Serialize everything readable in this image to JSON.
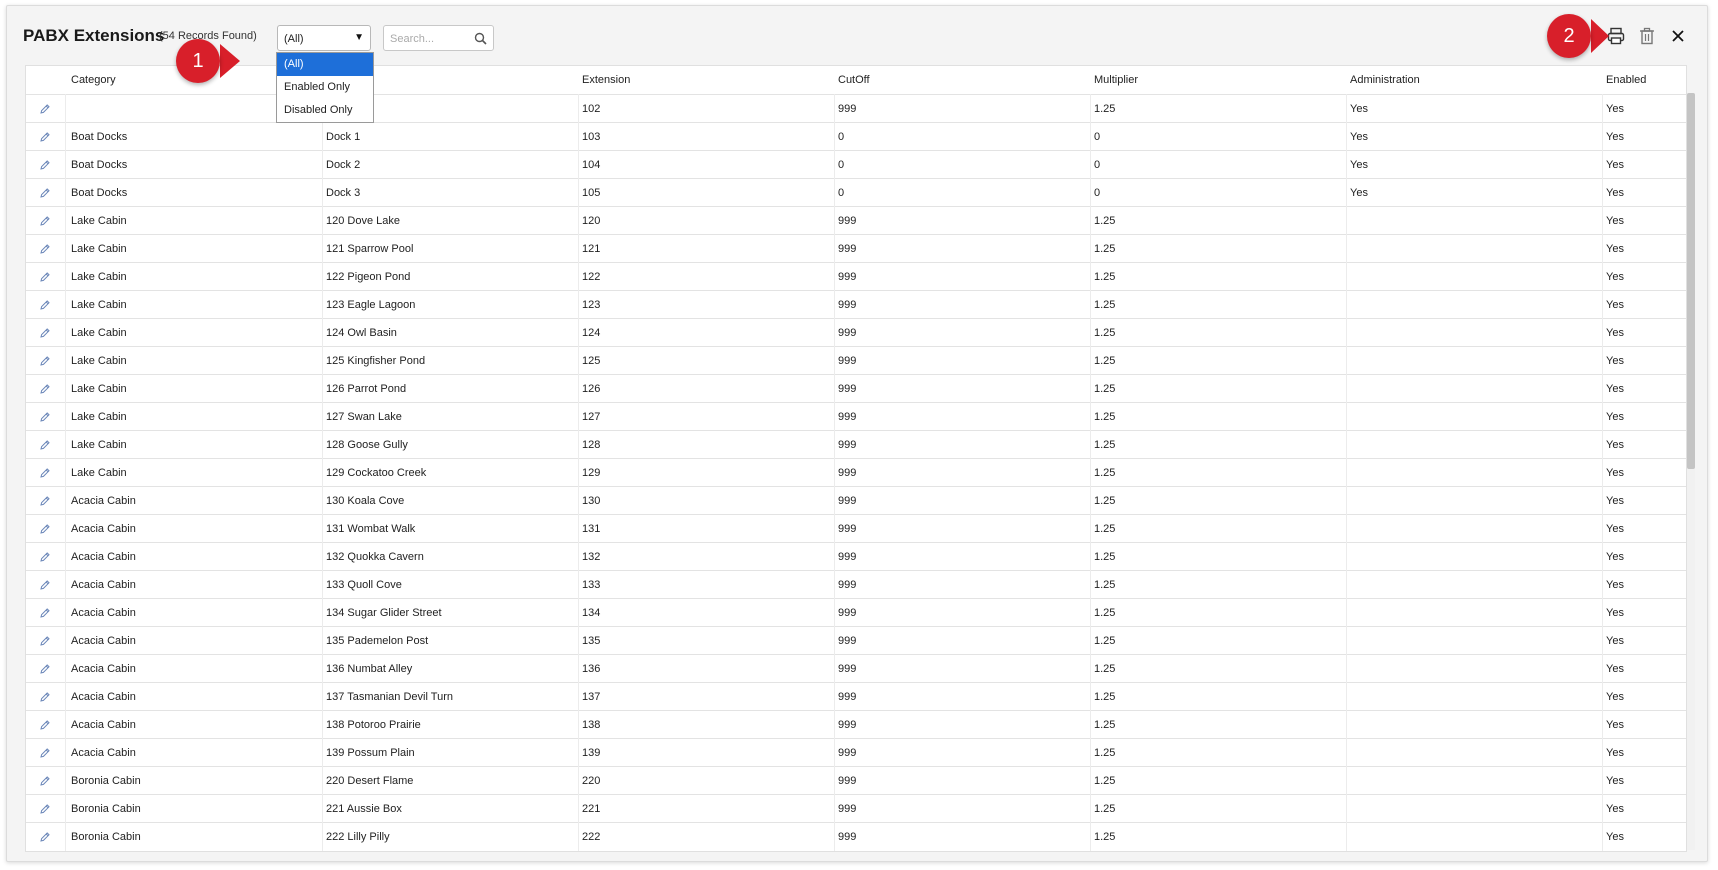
{
  "header": {
    "title": "PABX Extensions",
    "record_count": "(54 Records Found)",
    "filter_value": "(All)",
    "filter_options": [
      "(All)",
      "Enabled Only",
      "Disabled Only"
    ],
    "search_placeholder": "Search..."
  },
  "callouts": {
    "first": "1",
    "second": "2"
  },
  "colors": {
    "accent": "#1e6fd9",
    "callout": "#d81f2a"
  },
  "icons": {
    "print": "printer-icon",
    "delete": "trash-icon",
    "close": "close-icon",
    "edit": "pencil-icon",
    "search": "search-icon"
  },
  "table": {
    "columns": [
      "",
      "Category",
      "",
      "Extension",
      "CutOff",
      "Multiplier",
      "Administration",
      "Enabled"
    ],
    "rows": [
      [
        "",
        "",
        "102",
        "999",
        "1.25",
        "Yes",
        "Yes"
      ],
      [
        "Boat Docks",
        "Dock 1",
        "103",
        "0",
        "0",
        "Yes",
        "Yes"
      ],
      [
        "Boat Docks",
        "Dock 2",
        "104",
        "0",
        "0",
        "Yes",
        "Yes"
      ],
      [
        "Boat Docks",
        "Dock 3",
        "105",
        "0",
        "0",
        "Yes",
        "Yes"
      ],
      [
        "Lake Cabin",
        "120 Dove Lake",
        "120",
        "999",
        "1.25",
        "",
        "Yes"
      ],
      [
        "Lake Cabin",
        "121 Sparrow Pool",
        "121",
        "999",
        "1.25",
        "",
        "Yes"
      ],
      [
        "Lake Cabin",
        "122 Pigeon Pond",
        "122",
        "999",
        "1.25",
        "",
        "Yes"
      ],
      [
        "Lake Cabin",
        "123 Eagle Lagoon",
        "123",
        "999",
        "1.25",
        "",
        "Yes"
      ],
      [
        "Lake Cabin",
        "124 Owl Basin",
        "124",
        "999",
        "1.25",
        "",
        "Yes"
      ],
      [
        "Lake Cabin",
        "125 Kingfisher Pond",
        "125",
        "999",
        "1.25",
        "",
        "Yes"
      ],
      [
        "Lake Cabin",
        "126 Parrot Pond",
        "126",
        "999",
        "1.25",
        "",
        "Yes"
      ],
      [
        "Lake Cabin",
        "127 Swan Lake",
        "127",
        "999",
        "1.25",
        "",
        "Yes"
      ],
      [
        "Lake Cabin",
        "128 Goose Gully",
        "128",
        "999",
        "1.25",
        "",
        "Yes"
      ],
      [
        "Lake Cabin",
        "129 Cockatoo Creek",
        "129",
        "999",
        "1.25",
        "",
        "Yes"
      ],
      [
        "Acacia Cabin",
        "130 Koala Cove",
        "130",
        "999",
        "1.25",
        "",
        "Yes"
      ],
      [
        "Acacia Cabin",
        "131 Wombat Walk",
        "131",
        "999",
        "1.25",
        "",
        "Yes"
      ],
      [
        "Acacia Cabin",
        "132 Quokka Cavern",
        "132",
        "999",
        "1.25",
        "",
        "Yes"
      ],
      [
        "Acacia Cabin",
        "133 Quoll Cove",
        "133",
        "999",
        "1.25",
        "",
        "Yes"
      ],
      [
        "Acacia Cabin",
        "134 Sugar Glider Street",
        "134",
        "999",
        "1.25",
        "",
        "Yes"
      ],
      [
        "Acacia Cabin",
        "135 Pademelon Post",
        "135",
        "999",
        "1.25",
        "",
        "Yes"
      ],
      [
        "Acacia Cabin",
        "136 Numbat Alley",
        "136",
        "999",
        "1.25",
        "",
        "Yes"
      ],
      [
        "Acacia Cabin",
        "137 Tasmanian Devil Turn",
        "137",
        "999",
        "1.25",
        "",
        "Yes"
      ],
      [
        "Acacia Cabin",
        "138 Potoroo Prairie",
        "138",
        "999",
        "1.25",
        "",
        "Yes"
      ],
      [
        "Acacia Cabin",
        "139 Possum Plain",
        "139",
        "999",
        "1.25",
        "",
        "Yes"
      ],
      [
        "Boronia Cabin",
        "220 Desert Flame",
        "220",
        "999",
        "1.25",
        "",
        "Yes"
      ],
      [
        "Boronia Cabin",
        "221 Aussie Box",
        "221",
        "999",
        "1.25",
        "",
        "Yes"
      ],
      [
        "Boronia Cabin",
        "222 Lilly Pilly",
        "222",
        "999",
        "1.25",
        "",
        "Yes"
      ]
    ]
  }
}
